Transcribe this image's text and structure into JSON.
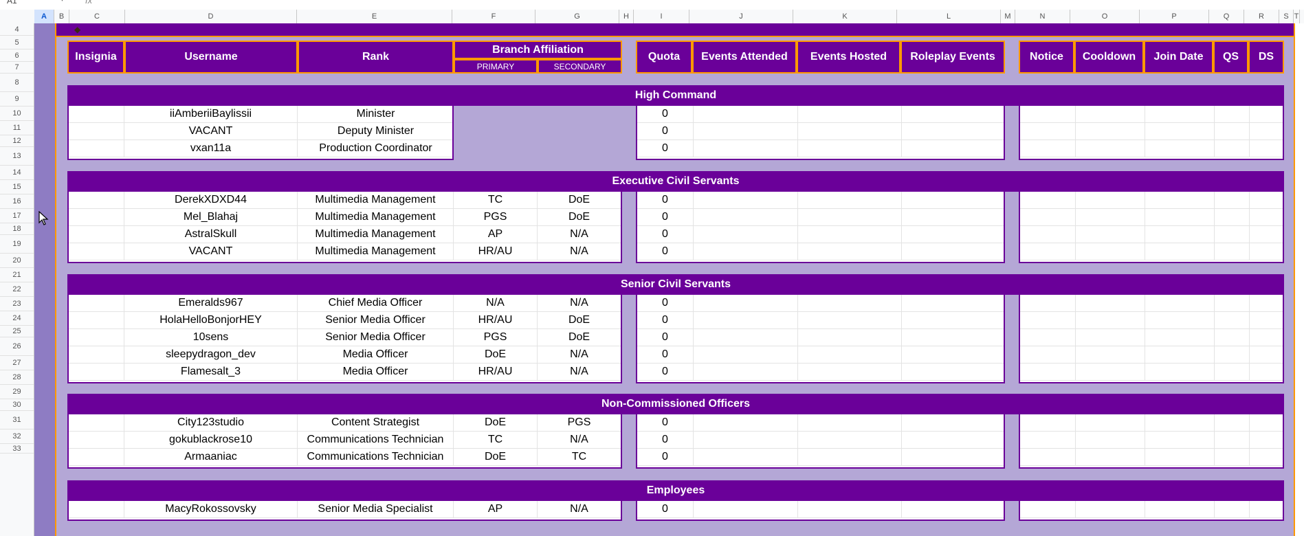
{
  "formula_bar": {
    "name_box": "A1",
    "fx": "fx"
  },
  "columns": [
    {
      "label": "A",
      "w": 29,
      "selected": true
    },
    {
      "label": "B",
      "w": 22
    },
    {
      "label": "C",
      "w": 81
    },
    {
      "label": "D",
      "w": 250
    },
    {
      "label": "E",
      "w": 226
    },
    {
      "label": "F",
      "w": 121
    },
    {
      "label": "G",
      "w": 122
    },
    {
      "label": "H",
      "w": 21
    },
    {
      "label": "I",
      "w": 81
    },
    {
      "label": "J",
      "w": 151
    },
    {
      "label": "K",
      "w": 151
    },
    {
      "label": "L",
      "w": 151
    },
    {
      "label": "M",
      "w": 21
    },
    {
      "label": "N",
      "w": 80
    },
    {
      "label": "O",
      "w": 101
    },
    {
      "label": "P",
      "w": 101
    },
    {
      "label": "Q",
      "w": 51
    },
    {
      "label": "R",
      "w": 51
    },
    {
      "label": "S",
      "w": 21
    },
    {
      "label": "T",
      "w": 9
    }
  ],
  "rows": [
    "4",
    "5",
    "6",
    "7",
    "8",
    "9",
    "10",
    "11",
    "12",
    "13",
    "14",
    "15",
    "16",
    "17",
    "18",
    "19",
    "20",
    "21",
    "22",
    "23",
    "24",
    "25",
    "26",
    "27",
    "28",
    "29",
    "30",
    "31",
    "32",
    "33"
  ],
  "headers": {
    "insignia": "Insignia",
    "username": "Username",
    "rank": "Rank",
    "branch": "Branch Affiliation",
    "primary": "PRIMARY",
    "secondary": "SECONDARY",
    "quota": "Quota",
    "events_attended": "Events Attended",
    "events_hosted": "Events Hosted",
    "roleplay_events": "Roleplay Events",
    "notice": "Notice",
    "cooldown": "Cooldown",
    "join_date": "Join Date",
    "qs": "QS",
    "ds": "DS"
  },
  "sections": [
    {
      "title": "High Command",
      "branch_shown": false,
      "members": [
        {
          "username": "iiAmberiiBaylissii",
          "rank": "Minister",
          "primary": "",
          "secondary": "",
          "quota": "0"
        },
        {
          "username": "VACANT",
          "rank": "Deputy Minister",
          "primary": "",
          "secondary": "",
          "quota": "0"
        },
        {
          "username": "vxan11a",
          "rank": "Production Coordinator",
          "primary": "",
          "secondary": "",
          "quota": "0"
        }
      ]
    },
    {
      "title": "Executive Civil Servants",
      "branch_shown": true,
      "members": [
        {
          "username": "DerekXDXD44",
          "rank": "Multimedia Management",
          "primary": "TC",
          "secondary": "DoE",
          "quota": "0"
        },
        {
          "username": "Mel_Blahaj",
          "rank": "Multimedia Management",
          "primary": "PGS",
          "secondary": "DoE",
          "quota": "0"
        },
        {
          "username": "AstralSkull",
          "rank": "Multimedia Management",
          "primary": "AP",
          "secondary": "N/A",
          "quota": "0"
        },
        {
          "username": "VACANT",
          "rank": "Multimedia Management",
          "primary": "HR/AU",
          "secondary": "N/A",
          "quota": "0"
        }
      ]
    },
    {
      "title": "Senior Civil Servants",
      "branch_shown": true,
      "members": [
        {
          "username": "Emeralds967",
          "rank": "Chief Media Officer",
          "primary": "N/A",
          "secondary": "N/A",
          "quota": "0"
        },
        {
          "username": "HolaHelloBonjorHEY",
          "rank": "Senior Media Officer",
          "primary": "HR/AU",
          "secondary": "DoE",
          "quota": "0"
        },
        {
          "username": "10sens",
          "rank": "Senior Media Officer",
          "primary": "PGS",
          "secondary": "DoE",
          "quota": "0"
        },
        {
          "username": "sleepydragon_dev",
          "rank": "Media Officer",
          "primary": "DoE",
          "secondary": "N/A",
          "quota": "0"
        },
        {
          "username": "Flamesalt_3",
          "rank": "Media Officer",
          "primary": "HR/AU",
          "secondary": "N/A",
          "quota": "0"
        }
      ]
    },
    {
      "title": "Non-Commissioned Officers",
      "branch_shown": true,
      "members": [
        {
          "username": "City123studio",
          "rank": "Content Strategist",
          "primary": "DoE",
          "secondary": "PGS",
          "quota": "0"
        },
        {
          "username": "gokublackrose10",
          "rank": "Communications Technician",
          "primary": "TC",
          "secondary": "N/A",
          "quota": "0"
        },
        {
          "username": "Armaaniac",
          "rank": "Communications Technician",
          "primary": "DoE",
          "secondary": "TC",
          "quota": "0"
        }
      ]
    },
    {
      "title": "Employees",
      "branch_shown": true,
      "members": [
        {
          "username": "MacyRokossovsky",
          "rank": "Senior Media Specialist",
          "primary": "AP",
          "secondary": "N/A",
          "quota": "0"
        }
      ]
    }
  ]
}
